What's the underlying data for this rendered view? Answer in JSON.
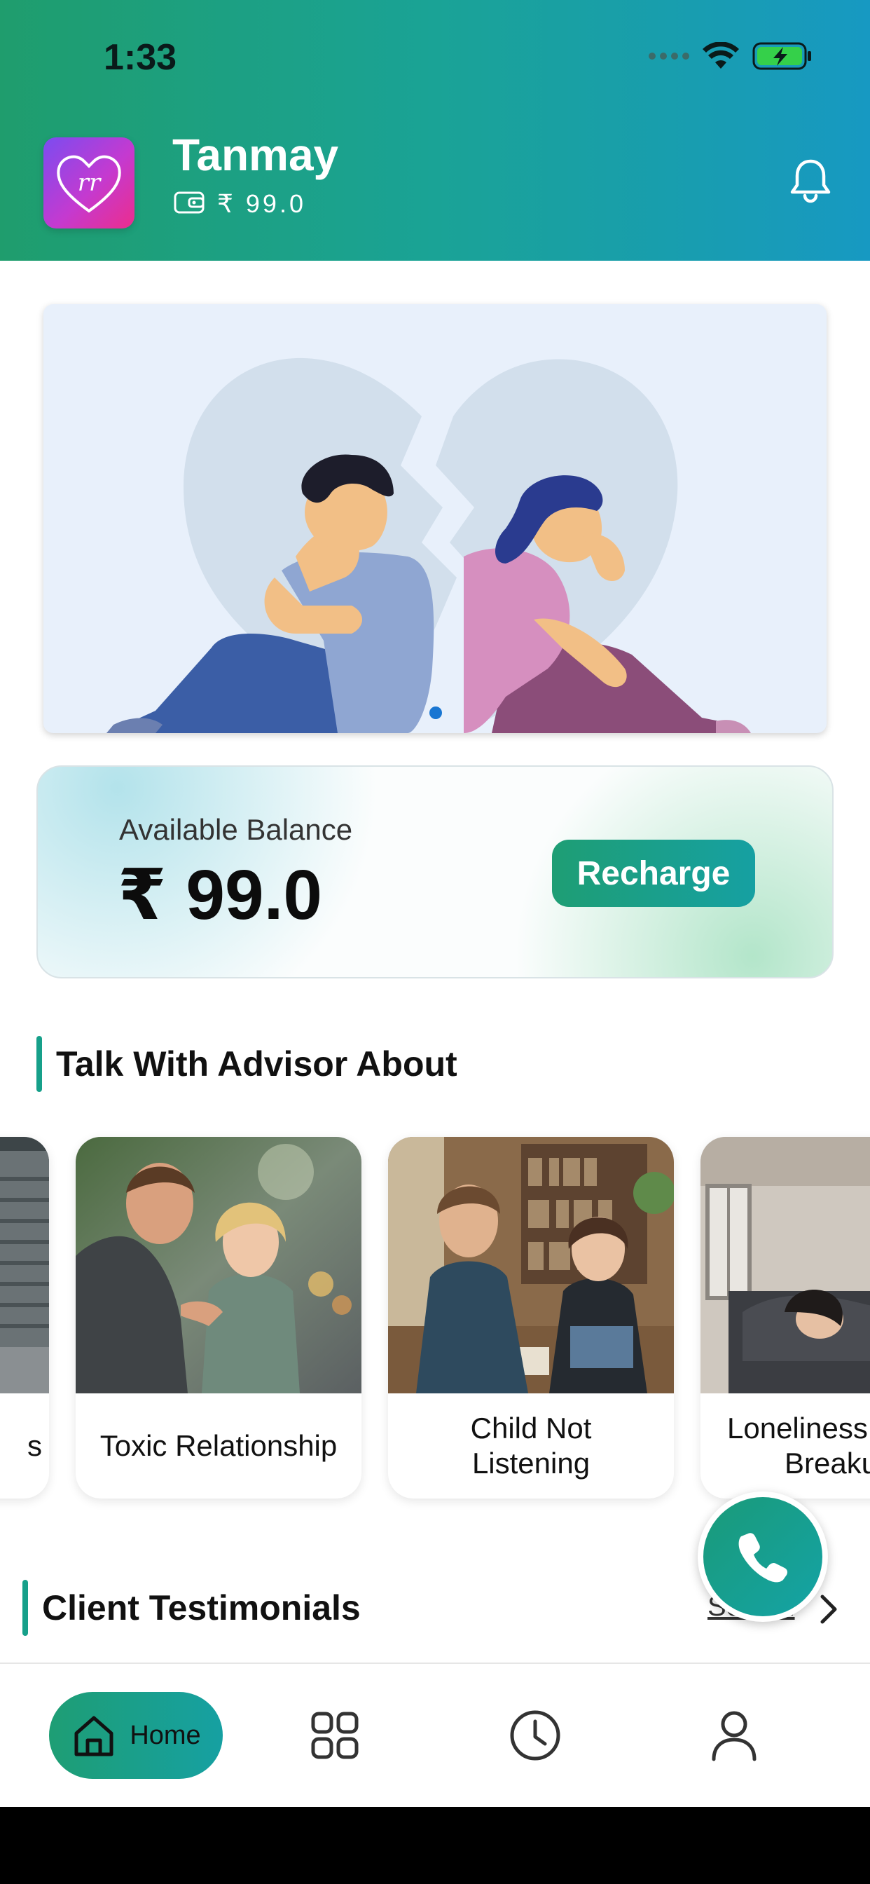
{
  "status_bar": {
    "time": "1:33"
  },
  "header": {
    "user_name": "Tanmay",
    "wallet_amount": "₹ 99.0",
    "avatar_monogram": "rr",
    "icons": [
      "wallet-icon",
      "bell-icon"
    ]
  },
  "banner": {
    "illustration": "broken heart couple illustration",
    "active_slide": 1,
    "slide_count": 1
  },
  "balance": {
    "label": "Available Balance",
    "value": "₹ 99.0",
    "recharge_label": "Recharge"
  },
  "sections": {
    "topics_title": "Talk With Advisor About",
    "testimonials_title": "Client Testimonials",
    "see_all_label": "See All"
  },
  "topics": [
    {
      "label": "s"
    },
    {
      "label": "Toxic Relationship"
    },
    {
      "label": "Child Not Listening"
    },
    {
      "label": "Loneliness After Breakup"
    }
  ],
  "topics_visible": [
    {
      "line1": "s",
      "line2": ""
    },
    {
      "line1": "Toxic Relationship",
      "line2": ""
    },
    {
      "line1": "Child Not",
      "line2": "Listening"
    },
    {
      "line1": "Loneliness",
      "line2": "Breaku"
    }
  ],
  "bottom_nav": {
    "home_label": "Home",
    "items": [
      "home-icon",
      "grid-icon",
      "clock-icon",
      "profile-icon"
    ],
    "active": "Home"
  },
  "colors": {
    "brand_green": "#1e9e74",
    "brand_teal": "#16a0a2",
    "banner_bg": "#e8f0fb",
    "dot_active": "#1976d2"
  }
}
